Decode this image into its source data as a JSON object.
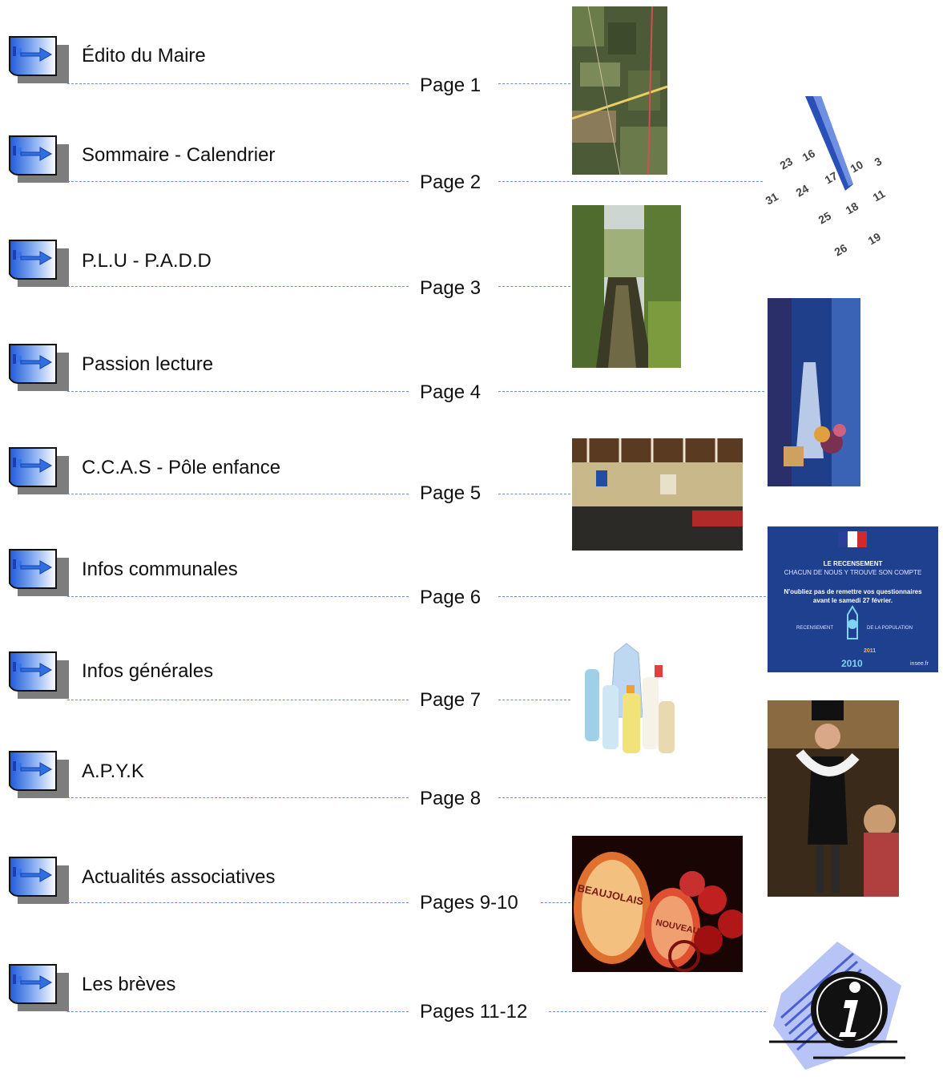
{
  "entries": [
    {
      "title": "Édito du Maire",
      "page": "Page 1"
    },
    {
      "title": "Sommaire - Calendrier",
      "page": "Page 2"
    },
    {
      "title": "P.L.U - P.A.D.D",
      "page": "Page 3"
    },
    {
      "title": "Passion lecture",
      "page": "Page 4"
    },
    {
      "title": "C.C.A.S - Pôle enfance",
      "page": "Page 5"
    },
    {
      "title": "Infos communales",
      "page": "Page 6"
    },
    {
      "title": "Infos générales",
      "page": "Page 7"
    },
    {
      "title": "A.P.Y.K",
      "page": "Page 8"
    },
    {
      "title": "Actualités associatives",
      "page": "Pages 9-10"
    },
    {
      "title": "Les brèves",
      "page": "Pages 11-12"
    }
  ],
  "images": {
    "calendar_numbers": [
      "3",
      "16",
      "23",
      "10",
      "17",
      "24",
      "31",
      "11",
      "18",
      "25",
      "19",
      "26"
    ],
    "census": {
      "line1": "LE RECENSEMENT",
      "line2": "CHACUN DE NOUS Y TROUVE SON COMPTE",
      "line3": "N'oubliez pas de remettre vos questionnaires",
      "line4": "avant le samedi 27 février.",
      "left_word": "RECENSEMENT",
      "right_word": "DE LA POPULATION",
      "year": "2010",
      "year2": "2011",
      "site": "insee.fr"
    },
    "barrel_text_1": "BEAUJOLAIS",
    "barrel_text_2": "NOUVEAU"
  },
  "colors": {
    "dotted_line": "#6b8fd1",
    "icon_blue": "#2f6fe0",
    "census_blue": "#1f3f8f"
  }
}
